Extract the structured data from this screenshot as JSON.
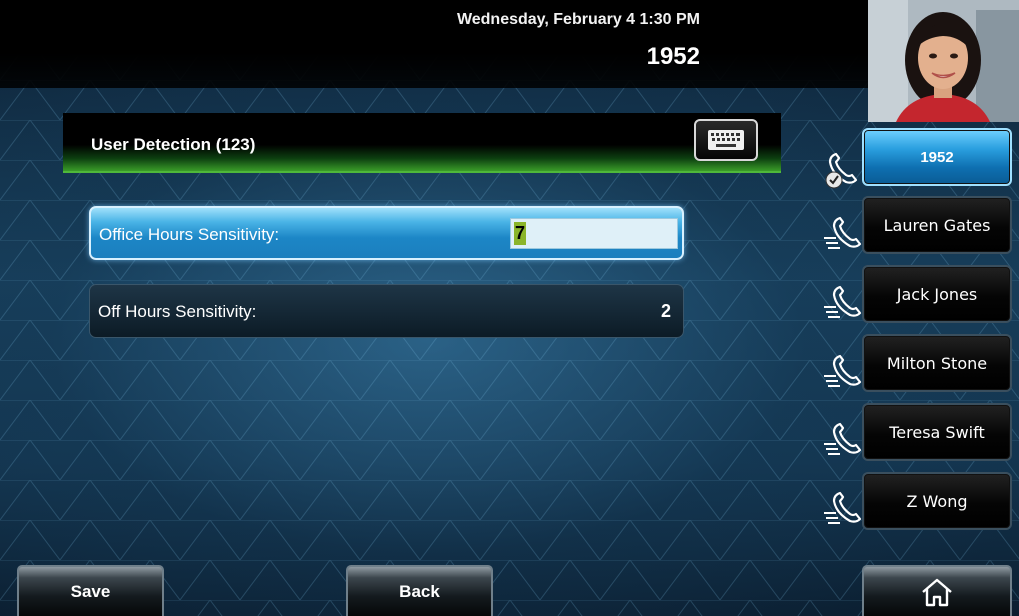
{
  "status": {
    "datetime": "Wednesday, February 4  1:30 PM",
    "extension": "1952"
  },
  "header": {
    "title": "User Detection (123)",
    "keyboard_icon": "keyboard-icon"
  },
  "settings": [
    {
      "label": "Office Hours Sensitivity:",
      "value": "7",
      "state": "editing"
    },
    {
      "label": "Off Hours Sensitivity:",
      "value": "2",
      "state": "normal"
    }
  ],
  "line_keys": [
    {
      "label": "1952",
      "icon": "phone-registered-icon",
      "active": true
    },
    {
      "label": "Lauren Gates",
      "icon": "phone-speed-dial-icon",
      "active": false
    },
    {
      "label": "Jack Jones",
      "icon": "phone-speed-dial-icon",
      "active": false
    },
    {
      "label": "Milton Stone",
      "icon": "phone-speed-dial-icon",
      "active": false
    },
    {
      "label": "Teresa Swift",
      "icon": "phone-speed-dial-icon",
      "active": false
    },
    {
      "label": "Z Wong",
      "icon": "phone-speed-dial-icon",
      "active": false
    }
  ],
  "softkeys": {
    "save": "Save",
    "back": "Back",
    "home_icon": "home-icon"
  },
  "colors": {
    "header_green": "#3a9c28",
    "selected_blue": "#1c86c6",
    "cursor_green": "#8bb52a"
  }
}
